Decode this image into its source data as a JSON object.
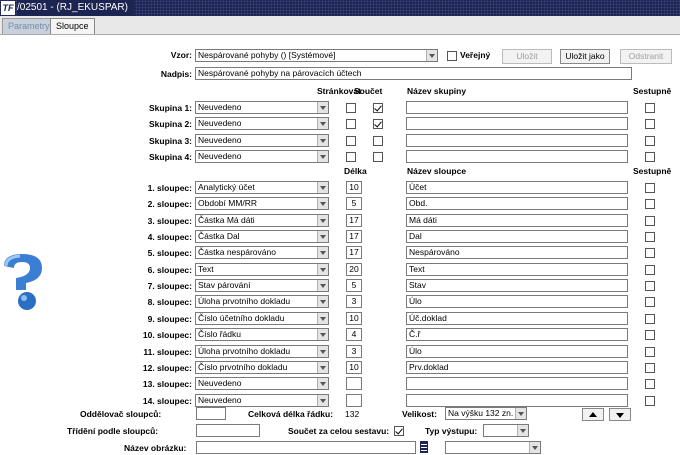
{
  "window": {
    "title": "/02501 - (RJ_EKUSPAR)",
    "logo": "TF"
  },
  "tabs": [
    {
      "label": "Parametry"
    },
    {
      "label": "Sloupce"
    }
  ],
  "vzor": {
    "label": "Vzor:",
    "value": "Nespárované pohyby   ()   [Systémové]",
    "verejny_label": "Veřejný",
    "verejny_checked": false,
    "ulozit": "Uložit",
    "ulozit_jako": "Uložit jako",
    "odstranit": "Odstranit"
  },
  "nadpis": {
    "label": "Nadpis:",
    "value": "Nespárované pohyby na párovacích účtech"
  },
  "group_headers": {
    "strankovat": "Stránkovat",
    "soucet": "Součet",
    "nazev": "Název skupiny",
    "sestupne": "Sestupně"
  },
  "groups": [
    {
      "label": "Skupina 1:",
      "value": "Neuvedeno",
      "strankovat": false,
      "soucet": true,
      "nazev": "",
      "sestupne": false
    },
    {
      "label": "Skupina 2:",
      "value": "Neuvedeno",
      "strankovat": false,
      "soucet": true,
      "nazev": "",
      "sestupne": false
    },
    {
      "label": "Skupina 3:",
      "value": "Neuvedeno",
      "strankovat": false,
      "soucet": false,
      "nazev": "",
      "sestupne": false
    },
    {
      "label": "Skupina 4:",
      "value": "Neuvedeno",
      "strankovat": false,
      "soucet": false,
      "nazev": "",
      "sestupne": false
    }
  ],
  "column_headers": {
    "delka": "Délka",
    "nazev": "Název sloupce",
    "sestupne": "Sestupně"
  },
  "columns": [
    {
      "label": "1. sloupec:",
      "value": "Analytický účet",
      "delka": "10",
      "nazev": "Účet"
    },
    {
      "label": "2. sloupec:",
      "value": "Období MM/RR",
      "delka": "5",
      "nazev": "Obd."
    },
    {
      "label": "3. sloupec:",
      "value": "Částka Má dáti",
      "delka": "17",
      "nazev": "Má dáti"
    },
    {
      "label": "4. sloupec:",
      "value": "Částka Dal",
      "delka": "17",
      "nazev": "Dal"
    },
    {
      "label": "5. sloupec:",
      "value": "Částka nespárováno",
      "delka": "17",
      "nazev": "Nespárováno"
    },
    {
      "label": "6. sloupec:",
      "value": "Text",
      "delka": "20",
      "nazev": "Text"
    },
    {
      "label": "7. sloupec:",
      "value": "Stav párování",
      "delka": "5",
      "nazev": "Stav"
    },
    {
      "label": "8. sloupec:",
      "value": "Úloha prvotního dokladu",
      "delka": "3",
      "nazev": "Úlo"
    },
    {
      "label": "9. sloupec:",
      "value": "Číslo účetního dokladu",
      "delka": "10",
      "nazev": "Úč.doklad"
    },
    {
      "label": "10. sloupec:",
      "value": "Číslo řádku",
      "delka": "4",
      "nazev": "Č.ř"
    },
    {
      "label": "11. sloupec:",
      "value": "Úloha prvotního dokladu",
      "delka": "3",
      "nazev": "Úlo"
    },
    {
      "label": "12. sloupec:",
      "value": "Číslo prvotního dokladu",
      "delka": "10",
      "nazev": "Prv.doklad"
    },
    {
      "label": "13. sloupec:",
      "value": "Neuvedeno",
      "delka": "",
      "nazev": ""
    },
    {
      "label": "14. sloupec:",
      "value": "Neuvedeno",
      "delka": "",
      "nazev": ""
    }
  ],
  "footer": {
    "oddelovac_label": "Oddělovač sloupců:",
    "oddelovac_value": "",
    "celkova_label": "Celková délka řádku:",
    "celkova_value": "132",
    "velikost_label": "Velikost:",
    "velikost_value": "Na výšku 132 zn.",
    "trideni_label": "Třídění podle sloupců:",
    "trideni_value": "",
    "soucet_label": "Součet za celou sestavu:",
    "soucet_checked": true,
    "typ_label": "Typ výstupu:",
    "typ_value": "",
    "obrazek_label": "Název obrázku:",
    "obrazek_value": "",
    "obrazek_select": ""
  }
}
